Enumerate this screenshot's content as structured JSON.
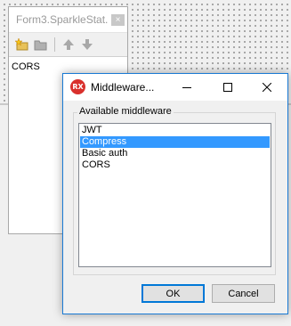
{
  "editor": {
    "title": "Form3.SparkleStat...",
    "close_glyph": "×",
    "toolbar": [
      "new-item-icon",
      "open-folder-icon",
      "arrow-up-icon",
      "arrow-down-icon"
    ],
    "items": [
      "CORS"
    ]
  },
  "dialog": {
    "title": "Middleware...",
    "app_icon_text": "RX",
    "group_label": "Available middleware",
    "items": [
      {
        "label": "JWT",
        "selected": false
      },
      {
        "label": "Compress",
        "selected": true
      },
      {
        "label": "Basic auth",
        "selected": false
      },
      {
        "label": "CORS",
        "selected": false
      }
    ],
    "ok_label": "OK",
    "cancel_label": "Cancel"
  },
  "colors": {
    "selection": "#3399ff",
    "accent": "#0078d7",
    "rx_icon": "#d9302c"
  }
}
